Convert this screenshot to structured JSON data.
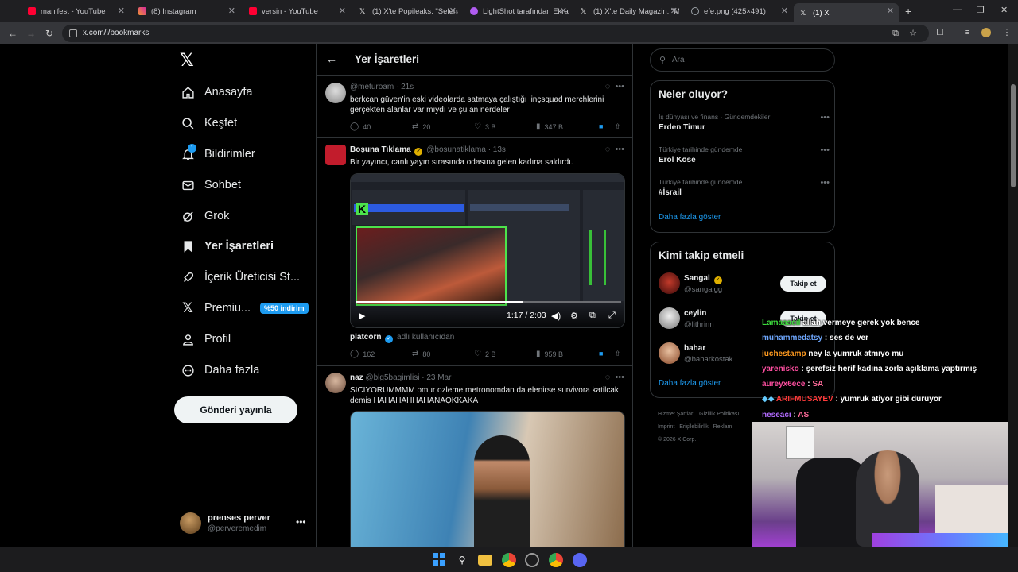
{
  "browser": {
    "tabs": [
      {
        "title": "manifest - YouTube",
        "favicon": "youtube-icon",
        "color": "#ff0033"
      },
      {
        "title": "(8) Instagram",
        "favicon": "instagram-icon",
        "color": "#d6249f"
      },
      {
        "title": "versin - YouTube",
        "favicon": "youtube-icon",
        "color": "#ff0033"
      },
      {
        "title": "(1) X'te Popileaks: \"Selena...",
        "favicon": "x-icon",
        "color": "#ffffff"
      },
      {
        "title": "LightShot tarafından Ekran...",
        "favicon": "lightshot-icon",
        "color": "#b05cf0"
      },
      {
        "title": "(1) X'te Daily Magazin: \"M...",
        "favicon": "x-icon",
        "color": "#ffffff"
      },
      {
        "title": "efe.png (425×491)",
        "favicon": "image-icon",
        "color": "#9aa0a6"
      },
      {
        "title": "(1) X",
        "favicon": "x-icon",
        "color": "#ffffff"
      }
    ],
    "url": "x.com/i/bookmarks"
  },
  "nav": {
    "items": [
      {
        "label": "Anasayfa",
        "icon": "home-icon"
      },
      {
        "label": "Keşfet",
        "icon": "search-icon"
      },
      {
        "label": "Bildirimler",
        "icon": "bell-icon",
        "badge": "1"
      },
      {
        "label": "Sohbet",
        "icon": "mail-icon"
      },
      {
        "label": "Grok",
        "icon": "grok-icon"
      },
      {
        "label": "Yer İşaretleri",
        "icon": "bookmark-icon"
      },
      {
        "label": "İçerik Üreticisi St...",
        "icon": "rocket-icon"
      },
      {
        "label": "Premiu...",
        "icon": "x-premium-icon",
        "pill": "%50 indirim"
      },
      {
        "label": "Profil",
        "icon": "person-icon"
      },
      {
        "label": "Daha fazla",
        "icon": "more-circle-icon"
      }
    ],
    "post_button": "Gönderi yayınla",
    "account": {
      "name": "prenses perver",
      "handle": "@perveremedim"
    }
  },
  "center": {
    "title": "Yer İşaretleri",
    "tweets": [
      {
        "handle": "@meturoam",
        "time": "21s",
        "text": "berkcan güven'in eski videolarda satmaya çalıştığı linçsquad merchlerini gerçekten alanlar var mıydı ve şu an nerdeler",
        "replies": "40",
        "reposts": "20",
        "likes": "3 B",
        "views": "347 B"
      },
      {
        "name": "Boşuna Tıklama",
        "handle": "@bosunatiklama",
        "time": "13s",
        "text": "Bir yayıncı, canlı yayın sırasında odasına gelen kadına saldırdı.",
        "video_time": "1:17 / 2:03",
        "video_progress": 0.63,
        "source": "platcorn",
        "source_suffix": "adlı kullanıcıdan",
        "replies": "162",
        "reposts": "80",
        "likes": "2 B",
        "views": "959 B"
      },
      {
        "name": "naz",
        "handle": "@blg5bagimlisi",
        "time": "23 Mar",
        "text": "SICIYORUMMMM omur ozleme metronomdan da elenirse survivora katilcak demis HAHAHAHHAHANAQKKAKA"
      }
    ]
  },
  "right": {
    "search_placeholder": "Ara",
    "trends_title": "Neler oluyor?",
    "trends": [
      {
        "context": "İş dünyası ve finans · Gündemdekiler",
        "topic": "Erden Timur"
      },
      {
        "context": "Türkiye tarihinde gündemde",
        "topic": "Erol Köse"
      },
      {
        "context": "Türkiye tarihinde gündemde",
        "topic": "#İsrail"
      }
    ],
    "trends_more": "Daha fazla göster",
    "wtf_title": "Kimi takip etmeli",
    "wtf": [
      {
        "name": "Sangal",
        "handle": "@sangalgg",
        "verified": true
      },
      {
        "name": "ceylin",
        "handle": "@lithrinn",
        "verified": false
      },
      {
        "name": "bahar",
        "handle": "@baharkostak",
        "verified": false
      }
    ],
    "follow_label": "Takip et",
    "wtf_more": "Daha fazla göster",
    "footer": [
      "Hizmet Şartları",
      "Gizlilik Politikası",
      "Imprint",
      "Erişilebilirlik",
      "Reklam",
      "© 2026 X Corp."
    ]
  },
  "chat": [
    {
      "user": "Lamaaacıl",
      "msg": "allah vermeye gerek yok bence",
      "color": "#3ddc3d"
    },
    {
      "user": "muhammedatsy",
      "msg": "ses de ver",
      "color": "#6fa8ff"
    },
    {
      "user": "juchestamp",
      "msg": "ney la yumruk atmıyo mu",
      "color": "#ff9a1f"
    },
    {
      "user": "yarenisko",
      "msg": "şerefsiz herif kadına zorla açıklama yaptırmış",
      "color": "#ff4fa1"
    },
    {
      "user": "aureyx6ece",
      "msg": "SA",
      "color": "#ff4fa1"
    },
    {
      "user": "ARIFMUSAYEV",
      "msg": "yumruk atiyor gibi duruyor",
      "color": "#ff3b3b"
    },
    {
      "user": "neseacı",
      "msg": "AS",
      "color": "#b36bff"
    }
  ]
}
